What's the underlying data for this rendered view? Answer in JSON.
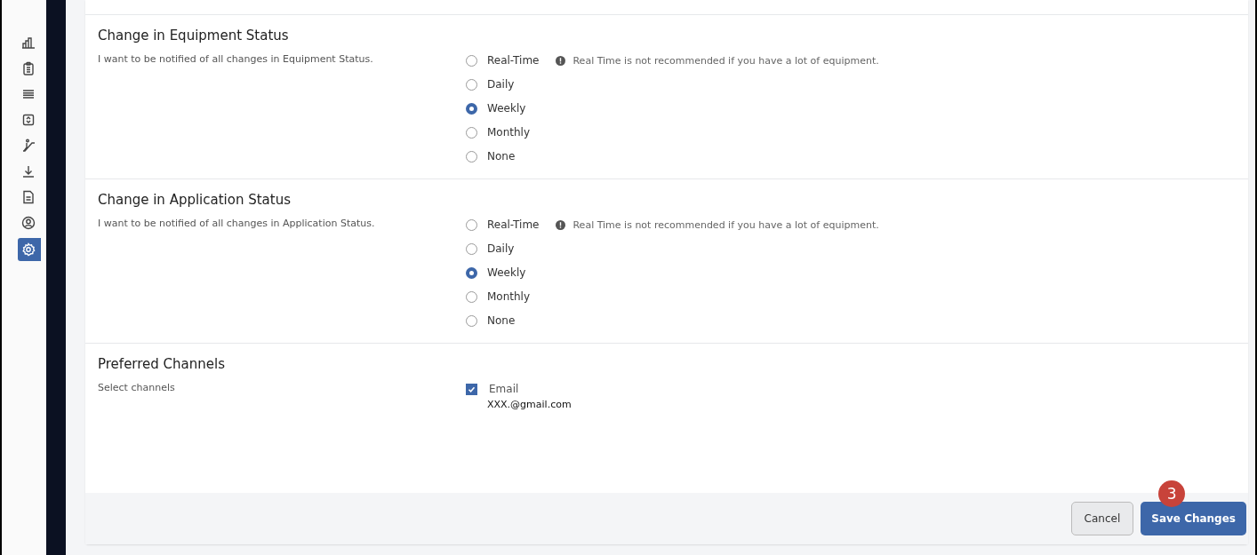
{
  "sidebar": {
    "items": [
      {
        "kind": "chart",
        "selected": false
      },
      {
        "kind": "clipboard",
        "selected": false
      },
      {
        "kind": "lines",
        "selected": false
      },
      {
        "kind": "expand",
        "selected": false
      },
      {
        "kind": "escalator",
        "selected": false
      },
      {
        "kind": "download",
        "selected": false
      },
      {
        "kind": "document",
        "selected": false
      },
      {
        "kind": "user",
        "selected": false
      },
      {
        "kind": "gear",
        "selected": true
      }
    ]
  },
  "sections": [
    {
      "kind": "radio",
      "title": "Change in Equipment Status",
      "description": "I want to be notified of all changes in Equipment Status.",
      "note": "Real Time is not recommended if you have a lot of equipment.",
      "options": [
        {
          "label": "Real-Time",
          "selected": false
        },
        {
          "label": "Daily",
          "selected": false
        },
        {
          "label": "Weekly",
          "selected": true
        },
        {
          "label": "Monthly",
          "selected": false
        },
        {
          "label": "None",
          "selected": false
        }
      ]
    },
    {
      "kind": "radio",
      "title": "Change in Application Status",
      "description": "I want to be notified of all changes in Application Status.",
      "note": "Real Time is not recommended if you have a lot of equipment.",
      "options": [
        {
          "label": "Real-Time",
          "selected": false
        },
        {
          "label": "Daily",
          "selected": false
        },
        {
          "label": "Weekly",
          "selected": true
        },
        {
          "label": "Monthly",
          "selected": false
        },
        {
          "label": "None",
          "selected": false
        }
      ]
    },
    {
      "kind": "checkbox",
      "title": "Preferred Channels",
      "description": "Select channels",
      "options": [
        {
          "label": "Email",
          "checked": true,
          "detail": "XXX.@gmail.com"
        }
      ]
    }
  ],
  "footer": {
    "cancel": "Cancel",
    "save": "Save Changes",
    "badge": "3"
  }
}
